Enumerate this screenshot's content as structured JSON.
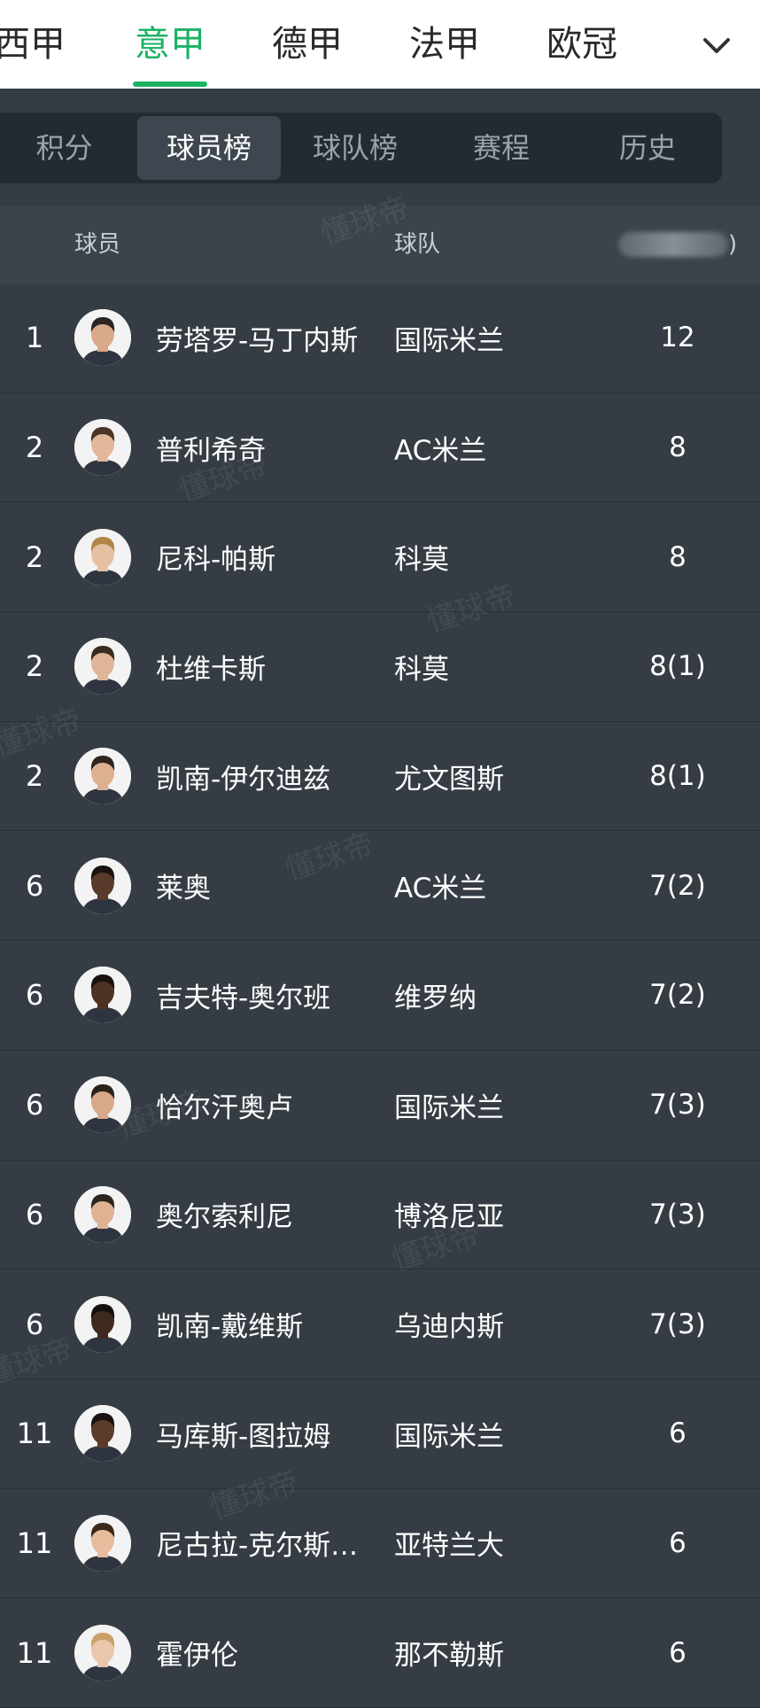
{
  "league_tabs": [
    {
      "label": "西甲",
      "active": false
    },
    {
      "label": "意甲",
      "active": true
    },
    {
      "label": "德甲",
      "active": false
    },
    {
      "label": "法甲",
      "active": false
    },
    {
      "label": "欧冠",
      "active": false
    }
  ],
  "sub_tabs": [
    {
      "label": "积分",
      "active": false
    },
    {
      "label": "球员榜",
      "active": true
    },
    {
      "label": "球队榜",
      "active": false
    },
    {
      "label": "赛程",
      "active": false
    },
    {
      "label": "历史",
      "active": false
    }
  ],
  "table": {
    "header": {
      "player": "球员",
      "team": "球队",
      "stat_suffix": ")"
    },
    "rows": [
      {
        "rank": "1",
        "name": "劳塔罗-马丁内斯",
        "team": "国际米兰",
        "goals": "12",
        "skin": "#d9a98a",
        "hair": "#2b2420"
      },
      {
        "rank": "2",
        "name": "普利希奇",
        "team": "AC米兰",
        "goals": "8",
        "skin": "#e3b89a",
        "hair": "#4a3526"
      },
      {
        "rank": "2",
        "name": "尼科-帕斯",
        "team": "科莫",
        "goals": "8",
        "skin": "#e6c0a2",
        "hair": "#b08548"
      },
      {
        "rank": "2",
        "name": "杜维卡斯",
        "team": "科莫",
        "goals": "8(1)",
        "skin": "#e0b496",
        "hair": "#3a2c22"
      },
      {
        "rank": "2",
        "name": "凯南-伊尔迪兹",
        "team": "尤文图斯",
        "goals": "8(1)",
        "skin": "#ddb090",
        "hair": "#2e2420"
      },
      {
        "rank": "6",
        "name": "莱奥",
        "team": "AC米兰",
        "goals": "7(2)",
        "skin": "#5a3a2a",
        "hair": "#1c1410"
      },
      {
        "rank": "6",
        "name": "吉夫特-奥尔班",
        "team": "维罗纳",
        "goals": "7(2)",
        "skin": "#4d3224",
        "hair": "#1a120e"
      },
      {
        "rank": "6",
        "name": "恰尔汗奥卢",
        "team": "国际米兰",
        "goals": "7(3)",
        "skin": "#d8a888",
        "hair": "#2c221c"
      },
      {
        "rank": "6",
        "name": "奥尔索利尼",
        "team": "博洛尼亚",
        "goals": "7(3)",
        "skin": "#e0b294",
        "hair": "#2e241e"
      },
      {
        "rank": "6",
        "name": "凯南-戴维斯",
        "team": "乌迪内斯",
        "goals": "7(3)",
        "skin": "#3e2a1f",
        "hair": "#15100c"
      },
      {
        "rank": "11",
        "name": "马库斯-图拉姆",
        "team": "国际米兰",
        "goals": "6",
        "skin": "#5b3c2b",
        "hair": "#1a1310"
      },
      {
        "rank": "11",
        "name": "尼古拉-克尔斯…",
        "team": "亚特兰大",
        "goals": "6",
        "skin": "#e6bc9c",
        "hair": "#3a2a1e"
      },
      {
        "rank": "11",
        "name": "霍伊伦",
        "team": "那不勒斯",
        "goals": "6",
        "skin": "#eac6aa",
        "hair": "#c9a066"
      }
    ]
  },
  "watermark_text": "懂球帝",
  "colors": {
    "accent": "#1db264",
    "background": "#353c44",
    "subtab_bar": "#232a31",
    "header_row": "#3c434b"
  }
}
